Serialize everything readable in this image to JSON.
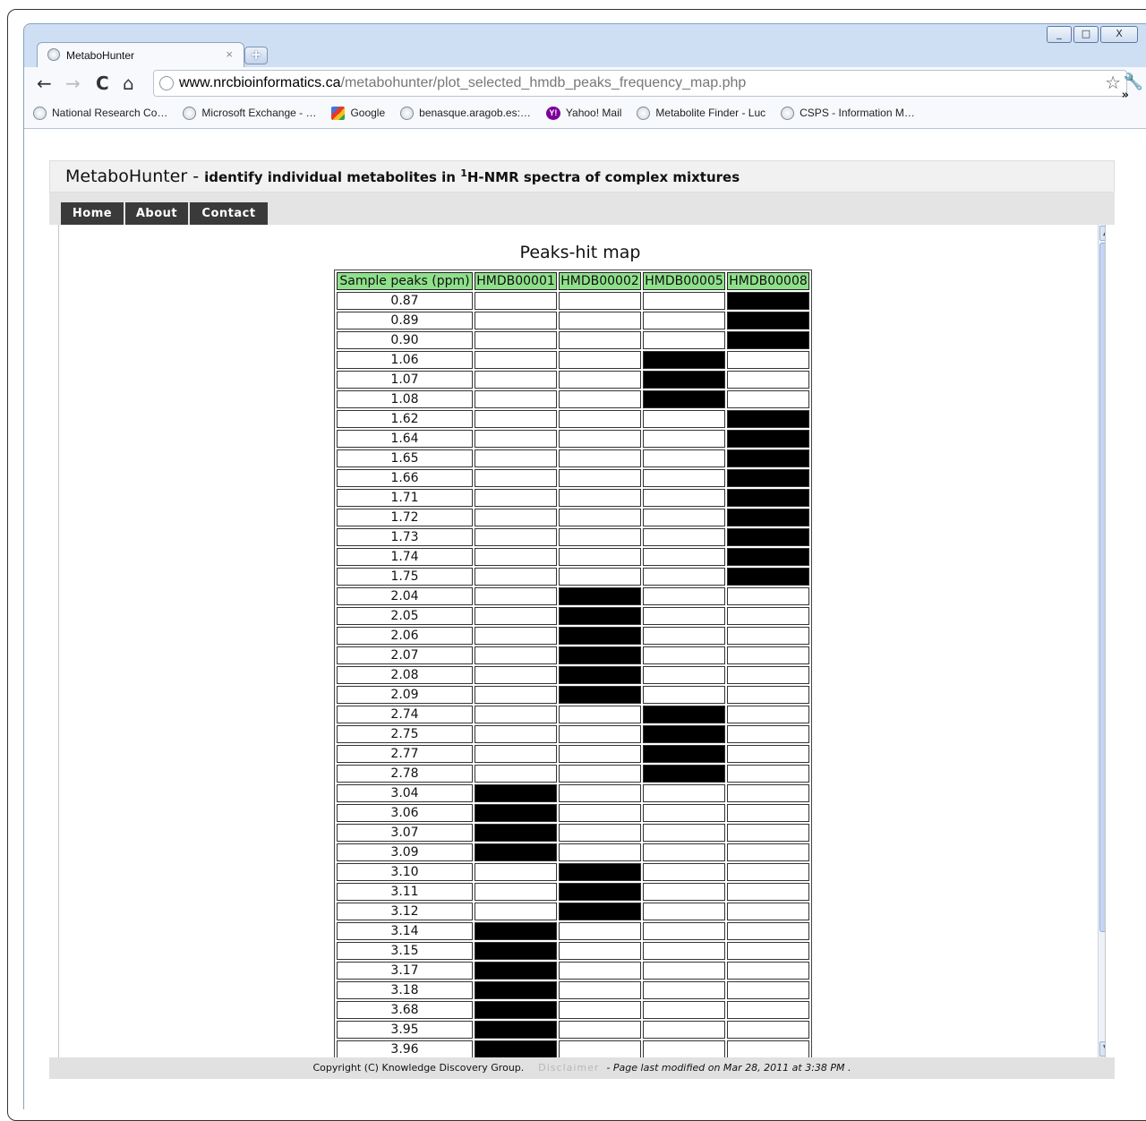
{
  "browser": {
    "tab_title": "MetaboHunter",
    "tab_close": "×",
    "new_tab": "+",
    "window_controls": [
      "_",
      "□",
      "X"
    ],
    "url_host": "www.nrcbioinformatics.ca",
    "url_path": "/metabohunter/plot_selected_hmdb_peaks_frequency_map.php",
    "nav_icons": [
      "back-arrow-icon",
      "forward-arrow-icon",
      "reload-icon",
      "home-icon"
    ],
    "bookmarks": [
      {
        "label": "National Research Co…",
        "icon": "globe"
      },
      {
        "label": "Microsoft Exchange - …",
        "icon": "globe"
      },
      {
        "label": "Google",
        "icon": "google"
      },
      {
        "label": "benasque.aragob.es:…",
        "icon": "globe"
      },
      {
        "label": "Yahoo! Mail",
        "icon": "yahoo"
      },
      {
        "label": "Metabolite Finder - Luc",
        "icon": "globe"
      },
      {
        "label": "CSPS - Information M…",
        "icon": "globe"
      }
    ],
    "bookmarks_more": "»"
  },
  "site": {
    "name": "MetaboHunter",
    "separator": " - ",
    "tagline_pre": "identify individual metabolites in ",
    "tagline_sup": "1",
    "tagline_post": "H-NMR spectra of complex mixtures",
    "nav": [
      "Home",
      "About",
      "Contact"
    ]
  },
  "map": {
    "title": "Peaks-hit map",
    "columns": [
      "Sample peaks (ppm)",
      "HMDB00001",
      "HMDB00002",
      "HMDB00005",
      "HMDB00008"
    ],
    "rows": [
      {
        "ppm": "0.87",
        "hits": [
          0,
          0,
          0,
          1
        ]
      },
      {
        "ppm": "0.89",
        "hits": [
          0,
          0,
          0,
          1
        ]
      },
      {
        "ppm": "0.90",
        "hits": [
          0,
          0,
          0,
          1
        ]
      },
      {
        "ppm": "1.06",
        "hits": [
          0,
          0,
          1,
          0
        ]
      },
      {
        "ppm": "1.07",
        "hits": [
          0,
          0,
          1,
          0
        ]
      },
      {
        "ppm": "1.08",
        "hits": [
          0,
          0,
          1,
          0
        ]
      },
      {
        "ppm": "1.62",
        "hits": [
          0,
          0,
          0,
          1
        ]
      },
      {
        "ppm": "1.64",
        "hits": [
          0,
          0,
          0,
          1
        ]
      },
      {
        "ppm": "1.65",
        "hits": [
          0,
          0,
          0,
          1
        ]
      },
      {
        "ppm": "1.66",
        "hits": [
          0,
          0,
          0,
          1
        ]
      },
      {
        "ppm": "1.71",
        "hits": [
          0,
          0,
          0,
          1
        ]
      },
      {
        "ppm": "1.72",
        "hits": [
          0,
          0,
          0,
          1
        ]
      },
      {
        "ppm": "1.73",
        "hits": [
          0,
          0,
          0,
          1
        ]
      },
      {
        "ppm": "1.74",
        "hits": [
          0,
          0,
          0,
          1
        ]
      },
      {
        "ppm": "1.75",
        "hits": [
          0,
          0,
          0,
          1
        ]
      },
      {
        "ppm": "2.04",
        "hits": [
          0,
          1,
          0,
          0
        ]
      },
      {
        "ppm": "2.05",
        "hits": [
          0,
          1,
          0,
          0
        ]
      },
      {
        "ppm": "2.06",
        "hits": [
          0,
          1,
          0,
          0
        ]
      },
      {
        "ppm": "2.07",
        "hits": [
          0,
          1,
          0,
          0
        ]
      },
      {
        "ppm": "2.08",
        "hits": [
          0,
          1,
          0,
          0
        ]
      },
      {
        "ppm": "2.09",
        "hits": [
          0,
          1,
          0,
          0
        ]
      },
      {
        "ppm": "2.74",
        "hits": [
          0,
          0,
          1,
          0
        ]
      },
      {
        "ppm": "2.75",
        "hits": [
          0,
          0,
          1,
          0
        ]
      },
      {
        "ppm": "2.77",
        "hits": [
          0,
          0,
          1,
          0
        ]
      },
      {
        "ppm": "2.78",
        "hits": [
          0,
          0,
          1,
          0
        ]
      },
      {
        "ppm": "3.04",
        "hits": [
          1,
          0,
          0,
          0
        ]
      },
      {
        "ppm": "3.06",
        "hits": [
          1,
          0,
          0,
          0
        ]
      },
      {
        "ppm": "3.07",
        "hits": [
          1,
          0,
          0,
          0
        ]
      },
      {
        "ppm": "3.09",
        "hits": [
          1,
          0,
          0,
          0
        ]
      },
      {
        "ppm": "3.10",
        "hits": [
          0,
          1,
          0,
          0
        ]
      },
      {
        "ppm": "3.11",
        "hits": [
          0,
          1,
          0,
          0
        ]
      },
      {
        "ppm": "3.12",
        "hits": [
          0,
          1,
          0,
          0
        ]
      },
      {
        "ppm": "3.14",
        "hits": [
          1,
          0,
          0,
          0
        ]
      },
      {
        "ppm": "3.15",
        "hits": [
          1,
          0,
          0,
          0
        ]
      },
      {
        "ppm": "3.17",
        "hits": [
          1,
          0,
          0,
          0
        ]
      },
      {
        "ppm": "3.18",
        "hits": [
          1,
          0,
          0,
          0
        ]
      },
      {
        "ppm": "3.68",
        "hits": [
          1,
          0,
          0,
          0
        ]
      },
      {
        "ppm": "3.95",
        "hits": [
          1,
          0,
          0,
          0
        ]
      },
      {
        "ppm": "3.96",
        "hits": [
          1,
          0,
          0,
          0
        ]
      }
    ],
    "colors": {
      "header_bg": "#8fe08b",
      "hit": "#000000",
      "empty": "#ffffff"
    }
  },
  "footer": {
    "copyright": "Copyright (C) Knowledge Discovery Group.",
    "disclaimer": "Disclaimer",
    "dash": "-",
    "modified": "Page last modified on Mar 28, 2011 at 3:38 PM ."
  }
}
